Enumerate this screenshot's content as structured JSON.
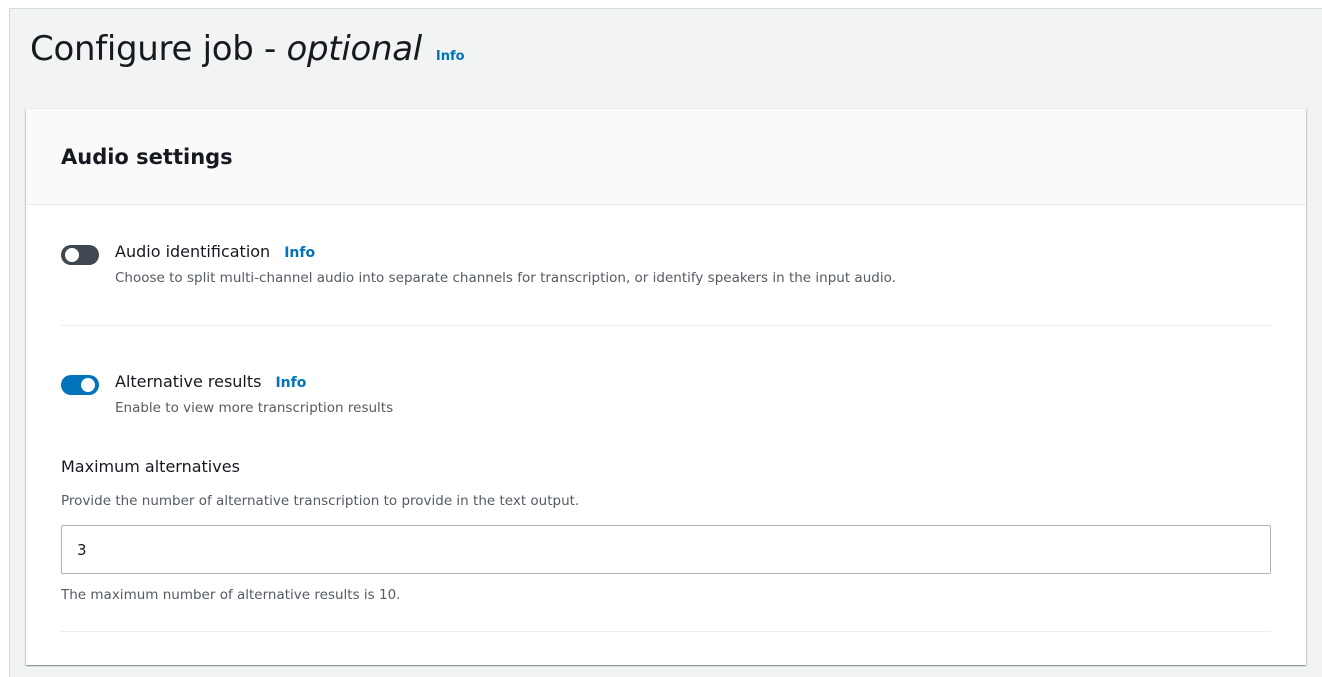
{
  "header": {
    "title_main": "Configure job - ",
    "title_emphasis": "optional",
    "info_label": "Info"
  },
  "audio_settings": {
    "title": "Audio settings",
    "audio_identification": {
      "label": "Audio identification",
      "info_label": "Info",
      "description": "Choose to split multi-channel audio into separate channels for transcription, or identify speakers in the input audio.",
      "enabled": false
    },
    "alternative_results": {
      "label": "Alternative results",
      "info_label": "Info",
      "description": "Enable to view more transcription results",
      "enabled": true
    },
    "maximum_alternatives": {
      "label": "Maximum alternatives",
      "description": "Provide the number of alternative transcription to provide in the text output.",
      "value": "3",
      "constraint": "The maximum number of alternative results is 10."
    }
  },
  "colors": {
    "accent": "#0073bb",
    "toggle_off": "#414750",
    "background": "#f2f3f3",
    "text": "#16191f",
    "secondary_text": "#545b64"
  }
}
